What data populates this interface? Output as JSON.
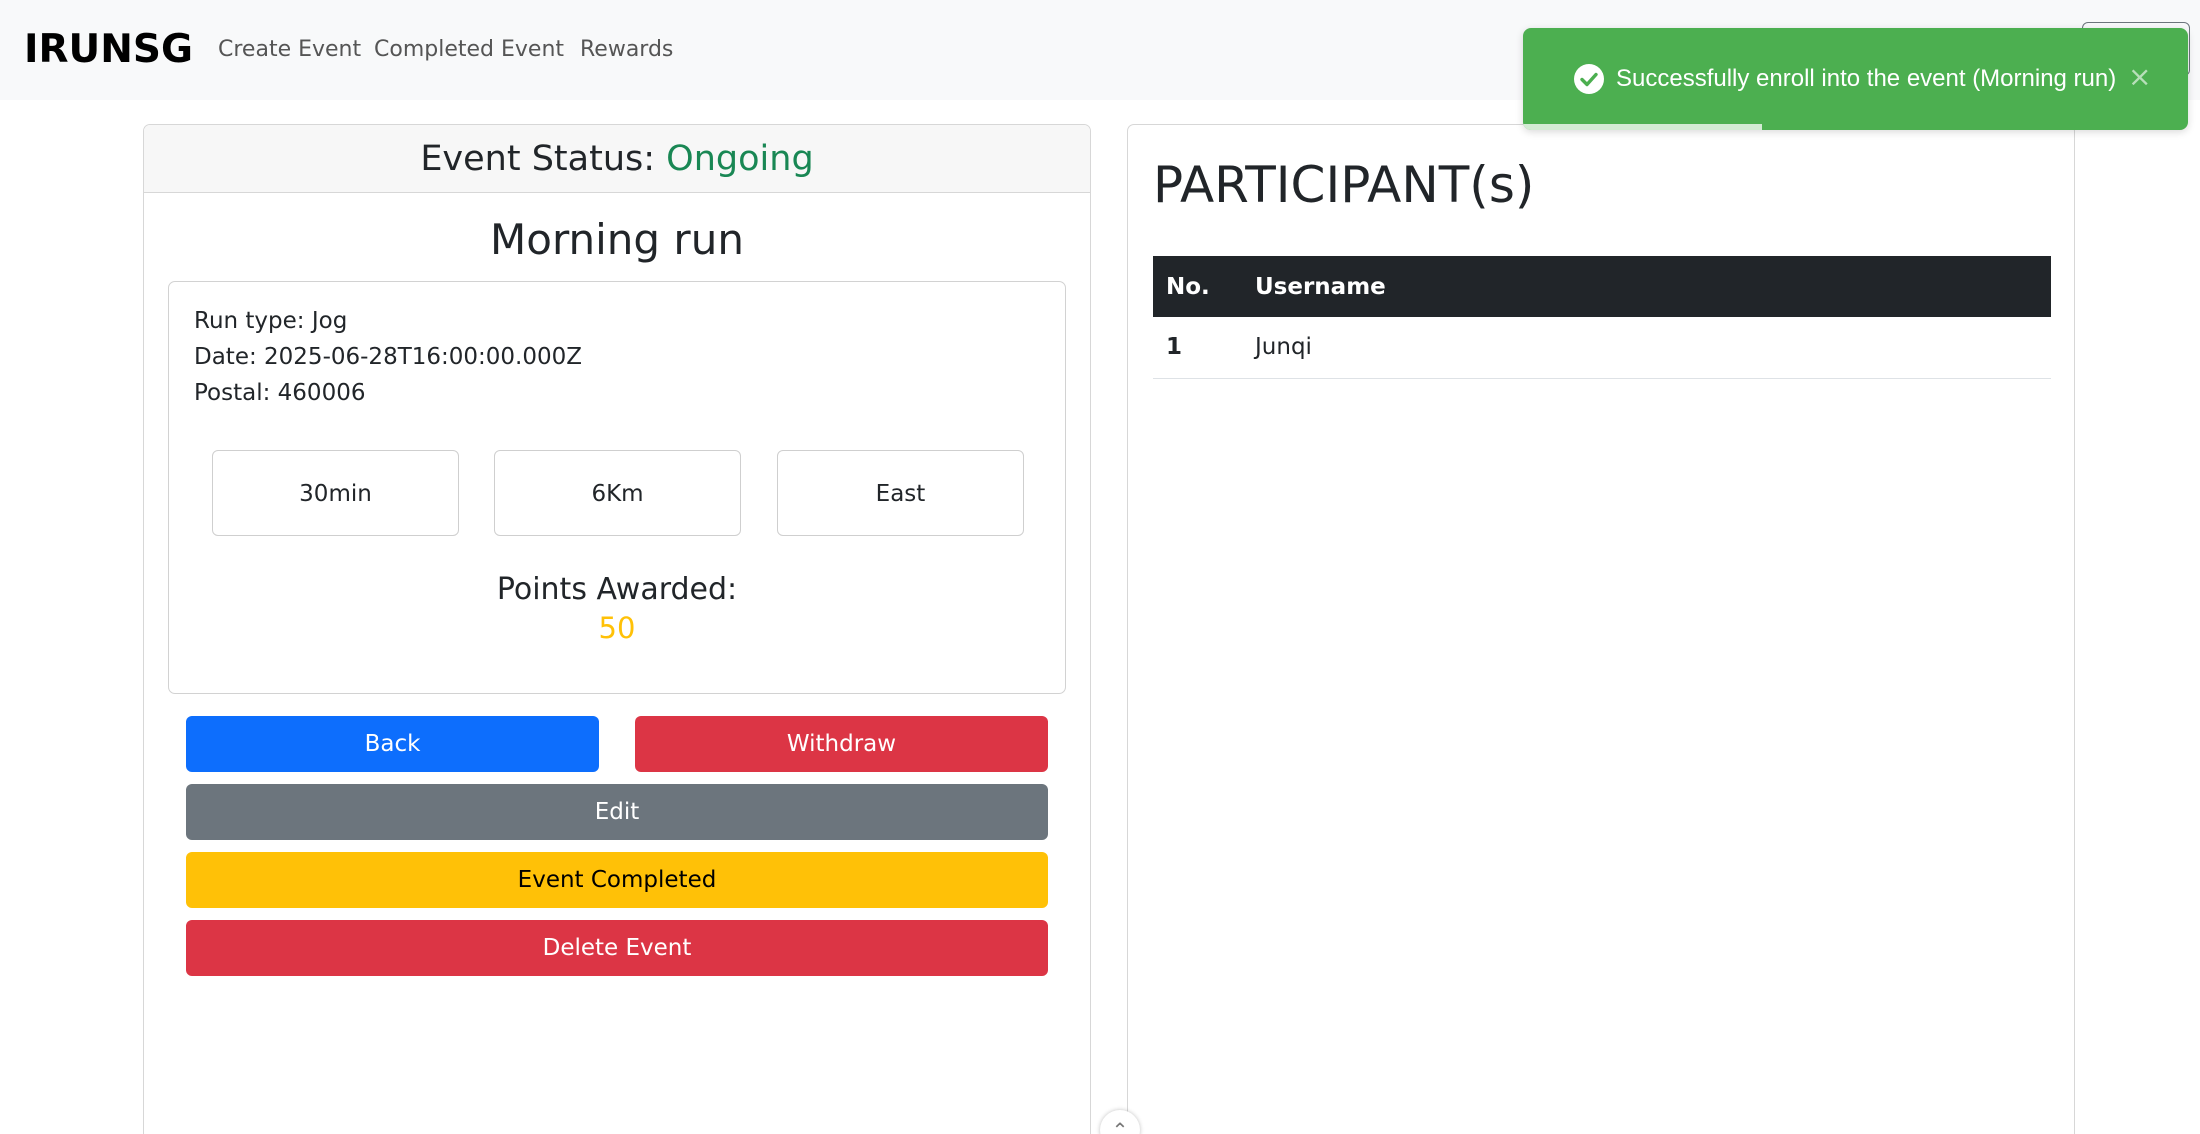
{
  "navbar": {
    "brand": "IRUNSG",
    "links": [
      "Create Event",
      "Completed Event",
      "Rewards"
    ]
  },
  "event": {
    "status_label": "Event Status:",
    "status_value": "Ongoing",
    "title": "Morning run",
    "run_type": "Run type: Jog",
    "date": "Date: 2025-06-28T16:00:00.000Z",
    "postal": "Postal: 460006",
    "duration": "30min",
    "distance": "6Km",
    "region": "East",
    "points_label": "Points Awarded:",
    "points_value": "50"
  },
  "buttons": {
    "back": "Back",
    "withdraw": "Withdraw",
    "edit": "Edit",
    "completed": "Event Completed",
    "delete": "Delete Event"
  },
  "participants": {
    "title": "PARTICIPANT(s)",
    "columns": [
      "No.",
      "Username"
    ],
    "rows": [
      {
        "no": "1",
        "username": "Junqi"
      }
    ]
  },
  "toast": {
    "message": "Successfully enroll into the event (Morning run)",
    "close": "×",
    "progress": 0.36
  },
  "colors": {
    "success": "#198754",
    "primary": "#0d6efd",
    "danger": "#dc3545",
    "secondary": "#6c757d",
    "warning": "#ffc107",
    "toast": "#4caf50"
  }
}
